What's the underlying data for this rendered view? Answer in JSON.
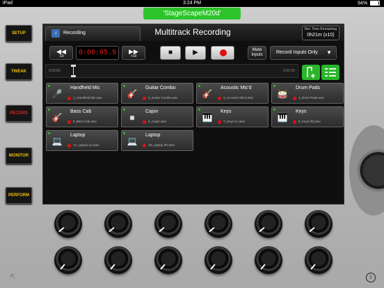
{
  "status_bar": {
    "carrier": "iPad",
    "time": "3:24 PM",
    "battery": "94%",
    "battery_level": 0.94
  },
  "device_name": "'StageScapeM20d'",
  "side_buttons": [
    {
      "label": "SETUP",
      "active": false
    },
    {
      "label": "TWEAK",
      "active": false
    },
    {
      "label": "RECORD",
      "active": true
    },
    {
      "label": "MONITOR",
      "active": false
    },
    {
      "label": "PERFORM",
      "active": false
    }
  ],
  "header": {
    "tab_label": "Recording",
    "tab_icon": "app-icon",
    "title": "Multitrack Recording",
    "rec_time_label": "Rec Time Remaining",
    "rec_time_value": "0h21m (x10)"
  },
  "transport": {
    "rewind_label": "-10",
    "counter": "0:00:05.9",
    "forward_label": "+10",
    "mute_label_line1": "Mute",
    "mute_label_line2": "Inputs",
    "record_mode": "Record Inputs Only"
  },
  "timeline": {
    "start": "0:00:00",
    "end": "0:01:00"
  },
  "tracks": [
    {
      "name": "Handheld Mic",
      "file": "1_Handheld Mic.wav",
      "icon": "microphone-icon"
    },
    {
      "name": "Guitar Combo",
      "file": "2_Guitar Combo.wav",
      "icon": "guitar-amp-icon"
    },
    {
      "name": "Acoustic Mic'd",
      "file": "3_Acoustic Mic'd.wav",
      "icon": "acoustic-guitar-icon"
    },
    {
      "name": "Drum Pads",
      "file": "4_Drum Pads.wav",
      "icon": "drum-pads-icon"
    },
    {
      "name": "Bass Cab",
      "file": "5_Bass Cab.wav",
      "icon": "bass-cab-icon"
    },
    {
      "name": "Cajon",
      "file": "6_Cajon.wav",
      "icon": "cajon-icon"
    },
    {
      "name": "Keys",
      "file": "7_Keys (L).wav",
      "icon": "keyboard-icon"
    },
    {
      "name": "Keys",
      "file": "8_Keys (R).wav",
      "icon": "keyboard-icon"
    },
    {
      "name": "Laptop",
      "file": "17_Laptop (L).wav",
      "icon": "laptop-icon"
    },
    {
      "name": "Laptop",
      "file": "18_Laptop (R).wav",
      "icon": "laptop-icon"
    }
  ],
  "colors": {
    "accent_green": "#2cc42a",
    "record_red": "#e01010",
    "side_label_yellow": "#f0c000"
  }
}
